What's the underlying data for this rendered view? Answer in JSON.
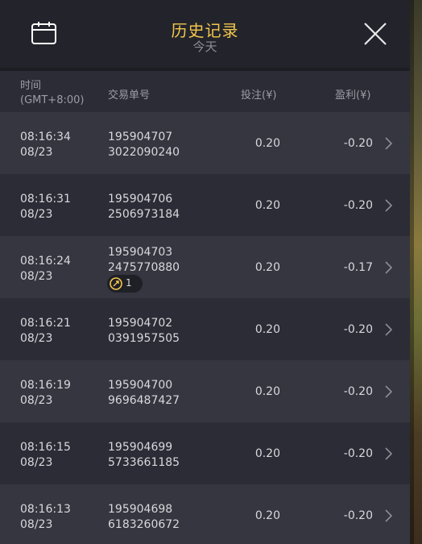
{
  "header": {
    "title": "历史记录",
    "subtitle": "今天"
  },
  "columns": {
    "time_line1": "时间",
    "time_line2": "(GMT+8:00)",
    "order": "交易单号",
    "bet": "投注(¥)",
    "profit": "盈利(¥)"
  },
  "rows": [
    {
      "time": "08:16:34",
      "date": "08/23",
      "order1": "195904707",
      "order2": "3022090240",
      "bet": "0.20",
      "profit": "-0.20"
    },
    {
      "time": "08:16:31",
      "date": "08/23",
      "order1": "195904706",
      "order2": "2506973184",
      "bet": "0.20",
      "profit": "-0.20"
    },
    {
      "time": "08:16:24",
      "date": "08/23",
      "order1": "195904703",
      "order2": "2475770880",
      "bet": "0.20",
      "profit": "-0.17",
      "badge_count": "1"
    },
    {
      "time": "08:16:21",
      "date": "08/23",
      "order1": "195904702",
      "order2": "0391957505",
      "bet": "0.20",
      "profit": "-0.20"
    },
    {
      "time": "08:16:19",
      "date": "08/23",
      "order1": "195904700",
      "order2": "9696487427",
      "bet": "0.20",
      "profit": "-0.20"
    },
    {
      "time": "08:16:15",
      "date": "08/23",
      "order1": "195904699",
      "order2": "5733661185",
      "bet": "0.20",
      "profit": "-0.20"
    },
    {
      "time": "08:16:13",
      "date": "08/23",
      "order1": "195904698",
      "order2": "6183260672",
      "bet": "0.20",
      "profit": "-0.20"
    }
  ],
  "icons": {
    "calendar": "calendar-icon",
    "close": "close-icon",
    "row_arrow": "chevron-right-icon",
    "badge": "coin-icon"
  },
  "colors": {
    "accent": "#f3c64d",
    "text": "#d8d9dd",
    "muted": "#9b9da5"
  }
}
